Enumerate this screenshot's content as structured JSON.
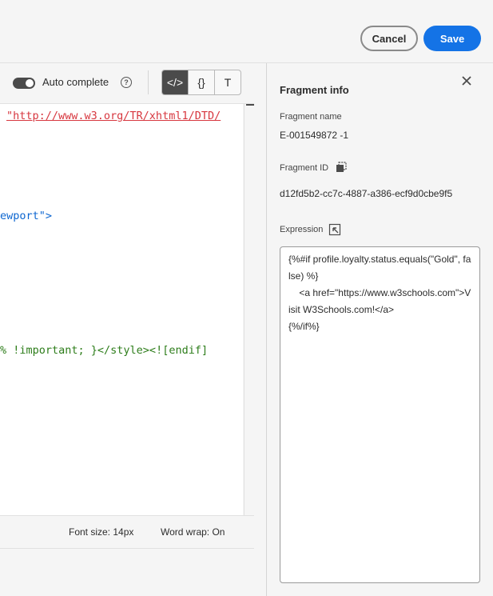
{
  "header": {
    "cancel_label": "Cancel",
    "save_label": "Save"
  },
  "editor": {
    "autocomplete_label": "Auto complete",
    "autocomplete_enabled": true,
    "help_symbol": "?",
    "modes": [
      "</>",
      "{}",
      "T"
    ],
    "code_lines": [
      {
        "text": "\"http://www.w3.org/TR/xhtml1/DTD/",
        "color": "red"
      },
      {
        "text": "ewport\">",
        "color": "blue"
      },
      {
        "text": "% !important; }</style><![endif]",
        "color": "green"
      }
    ],
    "font_size_label": "Font size: 14px",
    "word_wrap_label": "Word wrap: On"
  },
  "panel": {
    "title": "Fragment info",
    "name_label": "Fragment name",
    "name_value": "E-001549872 -1",
    "id_label": "Fragment ID",
    "id_value": "d12fd5b2-cc7c-4887-a386-ecf9d0cbe9f5",
    "expression_label": "Expression",
    "expression_value": "{%#if profile.loyalty.status.equals(\"Gold\", false) %}\n    <a href=\"https://www.w3schools.com\">Visit W3Schools.com!</a>\n{%/if%}"
  },
  "colors": {
    "accent": "#1473e6",
    "code_red": "#d7373f",
    "code_blue": "#0d66d0",
    "code_green": "#2d7d1a"
  }
}
